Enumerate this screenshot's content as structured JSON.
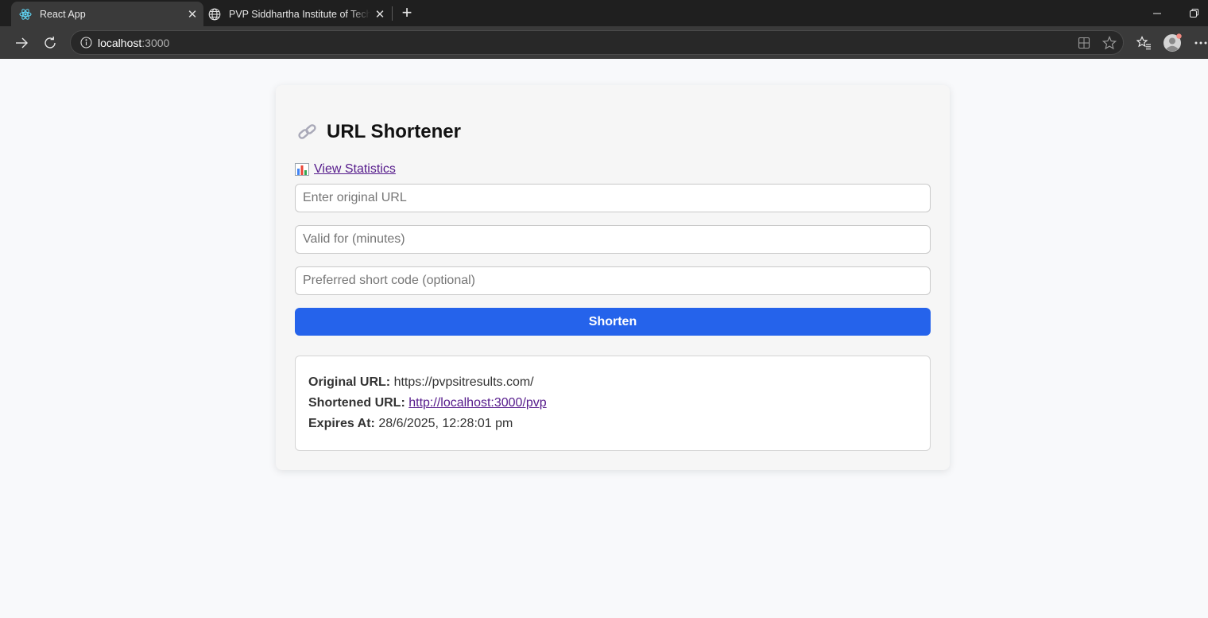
{
  "browser": {
    "tabs": [
      {
        "title": "React App",
        "active": true,
        "icon": "react-icon"
      },
      {
        "title": "PVP Siddhartha Institute of Technology",
        "active": false,
        "icon": "globe-icon"
      }
    ],
    "address": {
      "host": "localhost",
      "port": ":3000"
    }
  },
  "page": {
    "heading_emoji": "🔗",
    "title": "URL Shortener",
    "stats_link": "View Statistics",
    "inputs": {
      "original_url_placeholder": "Enter original URL",
      "validity_placeholder": "Valid for (minutes)",
      "shortcode_placeholder": "Preferred short code (optional)"
    },
    "shorten_button": "Shorten",
    "result": {
      "original_label": "Original URL:",
      "original_value": "https://pvpsitresults.com/",
      "short_label": "Shortened URL:",
      "short_value": "http://localhost:3000/pvp",
      "expires_label": "Expires At:",
      "expires_value": "28/6/2025, 12:28:01 pm"
    }
  },
  "colors": {
    "accent": "#2563eb",
    "link": "#551a8b",
    "page_bg": "#f8f9fb",
    "card_bg": "#f6f6f6"
  }
}
